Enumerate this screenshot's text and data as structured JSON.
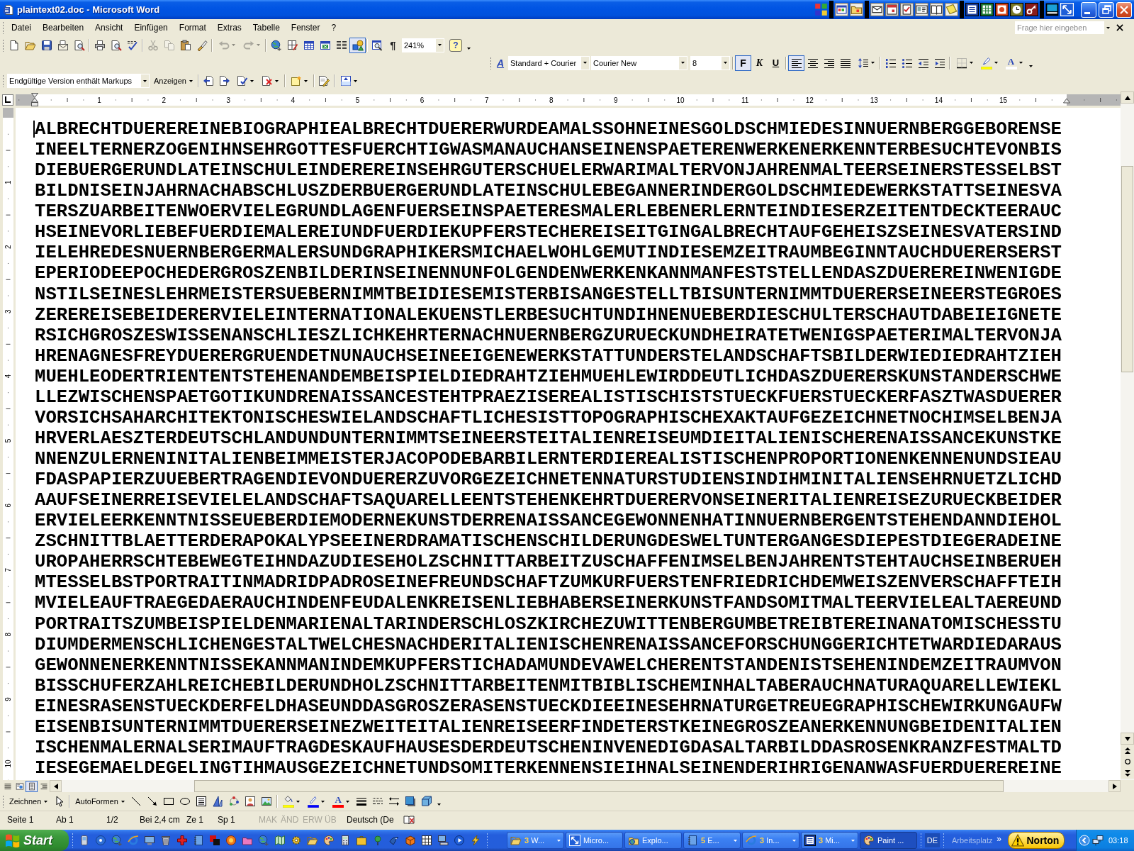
{
  "window": {
    "title": "plaintext02.doc - Microsoft Word"
  },
  "menu_bar": {
    "items": [
      "Datei",
      "Bearbeiten",
      "Ansicht",
      "Einfügen",
      "Format",
      "Extras",
      "Tabelle",
      "Fenster",
      "?"
    ],
    "help_search": {
      "placeholder": "Frage hier eingeben"
    }
  },
  "standard_toolbar": {
    "cut": {
      "disabled": true
    },
    "copy": {
      "disabled": true
    },
    "undo": {
      "disabled": true
    },
    "redo": {
      "disabled": true
    },
    "shapes": {
      "on": true
    },
    "pilcrow": "¶",
    "zoom": "241%",
    "help_glyph": "?"
  },
  "formatting_toolbar": {
    "styles_glyph": "A",
    "style": "Standard + Courier",
    "font": "Courier New",
    "size": "8",
    "style_buttons": [
      {
        "label": "F",
        "on": true
      },
      {
        "label": "K",
        "on": false
      },
      {
        "label": "U",
        "on": false
      }
    ],
    "alignment": [
      {
        "selected": true
      },
      {
        "selected": false
      },
      {
        "selected": false
      },
      {
        "selected": false
      }
    ],
    "font_color_glyph": "A"
  },
  "review_toolbar": {
    "display": "Endgültige Version enthält Markups",
    "show_menu": "Anzeigen"
  },
  "ruler": {
    "numbers": [
      "1",
      "2",
      "3",
      "4",
      "5",
      "6",
      "7",
      "8",
      "9",
      "10",
      "11",
      "12",
      "13",
      "14",
      "15"
    ]
  },
  "vertical_ruler": {
    "numbers": [
      "1",
      "2",
      "3",
      "4",
      "5",
      "6",
      "7",
      "8",
      "9",
      "10"
    ]
  },
  "document": {
    "lines": [
      "ALBRECHTDUEREREINEBIOGRAPHIEALBRECHTDUERERWURDEAMALSSOHNEINESGOLDSCHMIEDESINNUERNBERGGEBORENSE",
      "INEELTERNERZOGENIHNSEHRGOTTESFUERCHTIGWASMANAUCHANSEINENSPAETERENWERKENERKENNTERBESUCHTEVONBIS",
      "DIEBUERGERUNDLATEINSCHULEINDEREREINSEHRGUTERSCHUELERWARIMALTERVONJAHRENMALTEERSEINERSTESSELBST",
      "BILDNISEINJAHRNACHABSCHLUSZDERBUERGERUNDLATEINSCHULEBEGANNERINDERGOLDSCHMIEDEWERKSTATTSEINESVA",
      "TERSZUARBEITENWOERVIELEGRUNDLAGENFUERSEINSPAETERESMALERLEBENERLERNTEINDIESERZEITENTDECKTEERAUC",
      "HSEINEVORLIEBEFUERDIEMALEREIUNDFUERDIEKUPFERSTECHEREISEITGINGALBRECHTAUFGEHEISZSEINESVATERSIND",
      "IELEHREDESNUERNBERGERMALERSUNDGRAPHIKERSMICHAELWOHLGEMUTINDIESEMZEITRAUMBEGINNTAUCHDUERERSERST",
      "EPERIODEEPOCHEDERGROSZENBILDERINSEINENNUNFOLGENDENWERKENKANNMANFESTSTELLENDASZDUEREREINWENIGDE",
      "NSTILSEINESLEHRMEISTERSUEBERNIMMTBEIDIESEMISTERBISANGESTELLTBISUNTERNIMMTDUERERSEINEERSTEGROES",
      "ZEREREISEBEIDERERVIELEINTERNATIONALEKUENSTLERBESUCHTUNDIHNENUEBERDIESCHULTERSCHAUTDABEIEIGNETE",
      "RSICHGROSZESWISSENANSCHLIESZLICHKEHRTERNACHNUERNBERGZURUECKUNDHEIRATETWENIGSPAETERIMALTERVONJA",
      "HRENAGNESFREYDUERERGRUENDETNUNAUCHSEINEEIGENEWERKSTATTUNDERSTELANDSCHAFTSBILDERWIEDIEDRAHTZIEH",
      "MUEHLEODERTRIENTENTSTEHENANDEMBEISPIELDIEDRAHTZIEHMUEHLEWIRDDEUTLICHDASZDUERERSKUNSTANDERSCHWE",
      "LLEZWISCHENSPAETGOTIKUNDRENAISSANCESTEHTPRAEZISEREALISTISCHISTSTUECKFUERSTUECKERFASZTWASDUERER",
      "VORSICHSAHARCHITEKTONISCHESWIELANDSCHAFTLICHESISTTOPOGRAPHISCHEXAKTAUFGEZEICHNETNOCHIMSELBENJA",
      "HRVERLAESZTERDEUTSCHLANDUNDUNTERNIMMTSEINEERSTEITALIENREISEUMDIEITALIENISCHERENAISSANCEKUNSTKE",
      "NNENZULERNENINITALIENBEIMMEISTERJACOPODEBARBILERNTERDIEREALISTISCHENPROPORTIONENKENNENUNDSIEAU",
      "FDASPAPIERZUUEBERTRAGENDIEVONDUERERZUVORGEZEICHNETENNATURSTUDIENSINDIHMINITALIENSEHRNUETZLICHD",
      "AAUFSEINERREISEVIELELANDSCHAFTSAQUARELLEENTSTEHENKEHRTDUERERVONSEINERITALIENREISEZURUECKBEIDER",
      "ERVIELEERKENNTNISSEUEBERDIEMODERNEKUNSTDERRENAISSANCEGEWONNENHATINNUERNBERGENTSTEHENDANNDIEHOL",
      "ZSCHNITTBLAETTERDERAPOKALYPSEEINERDRAMATISCHENSCHILDERUNGDESWELTUNTERGANGESDIEPESTDIEGERADEINE",
      "UROPAHERRSCHTEBEWEGTEIHNDAZUDIESEHOLZSCHNITTARBEITZUSCHAFFENIMSELBENJAHRENTSTEHTAUCHSEINBERUEH",
      "MTESSELBSTPORTRAITINMADRIDPADROSEINEFREUNDSCHAFTZUMKURFUERSTENFRIEDRICHDEMWEISZENVERSCHAFFTEIH",
      "MVIELEAUFTRAEGEDAERAUCHINDENFEUDALENKREISENLIEBHABERSEINERKUNSTFANDSOMITMALTEERVIELEALTAEREUND",
      "PORTRAITSZUMBEISPIELDENMARIENALTARINDERSCHLOSZKIRCHEZUWITTENBERGUMBETREIBTEREINANATOMISCHESSTU",
      "DIUMDERMENSCHLICHENGESTALTWELCHESNACHDERITALIENISCHENRENAISSANCEFORSCHUNGGERICHTETWARDIEDARAUS",
      "GEWONNENERKENNTNISSEKANNMANINDEMKUPFERSTICHADAMUNDEVAWELCHERENTSTANDENISTSEHENINDEMZEITRAUMVON",
      "BISSCHUFERZAHLREICHEBILDERUNDHOLZSCHNITTARBEITENMITBIBLISCHEMINHALTABERAUCHNATURAQUARELLEWIEKL",
      "EINESRASENSTUECKDERFELDHASEUNDDASGROSZERASENSTUECKDIEEINESEHRNATURGETREUEGRAPHISCHEWIRKUNGAUFW",
      "EISENBISUNTERNIMMTDUERERSEINEZWEITEITALIENREISEERFINDETERSTKEINEGROSZEANERKENNUNGBEIDENITALIEN",
      "ISCHENMALERNALSERIMAUFTRAGDESKAUFHAUSESDERDEUTSCHENINVENEDIGDASALTARBILDDASROSENKRANZFESTMALTD",
      "IESEGEMAELDEGELINGTIHMAUSGEZEICHNETUNDSOMITERKENNENSIEIHNALSEINENDERIHRIGENANWASFUERDUEREREINE"
    ]
  },
  "view_buttons": [
    {
      "selected": false
    },
    {
      "selected": false
    },
    {
      "selected": true
    },
    {
      "selected": false
    }
  ],
  "drawing_toolbar": {
    "menu": "Zeichnen",
    "autoshapes": "AutoFormen",
    "font_color_glyph": "A"
  },
  "status_bar": {
    "page": "Seite 1",
    "section": "Ab 1",
    "pages": "1/2",
    "position": "Bei 2,4 cm",
    "line": "Ze 1",
    "column": "Sp 1",
    "modes": [
      {
        "label": "MAK",
        "active": false
      },
      {
        "label": "ÄND",
        "active": false
      },
      {
        "label": "ERW",
        "active": false
      },
      {
        "label": "ÜB",
        "active": false
      }
    ],
    "language": "Deutsch (De"
  },
  "taskbar": {
    "start": "Start",
    "tasks": [
      {
        "count": "3",
        "label": "W...",
        "selected": false
      },
      {
        "label": "Micro...",
        "selected": false
      },
      {
        "label": "Explo...",
        "selected": false
      },
      {
        "count": "5",
        "label": "E...",
        "selected": false
      },
      {
        "count": "3",
        "label": "In...",
        "selected": false
      },
      {
        "count": "3",
        "label": "Mi...",
        "selected": false
      },
      {
        "label": "Paint ...",
        "selected": true
      }
    ],
    "language": "DE",
    "toolbar_label": "Arbeitsplatz",
    "chevron": "»",
    "norton": "Norton",
    "clock": "03:18"
  }
}
